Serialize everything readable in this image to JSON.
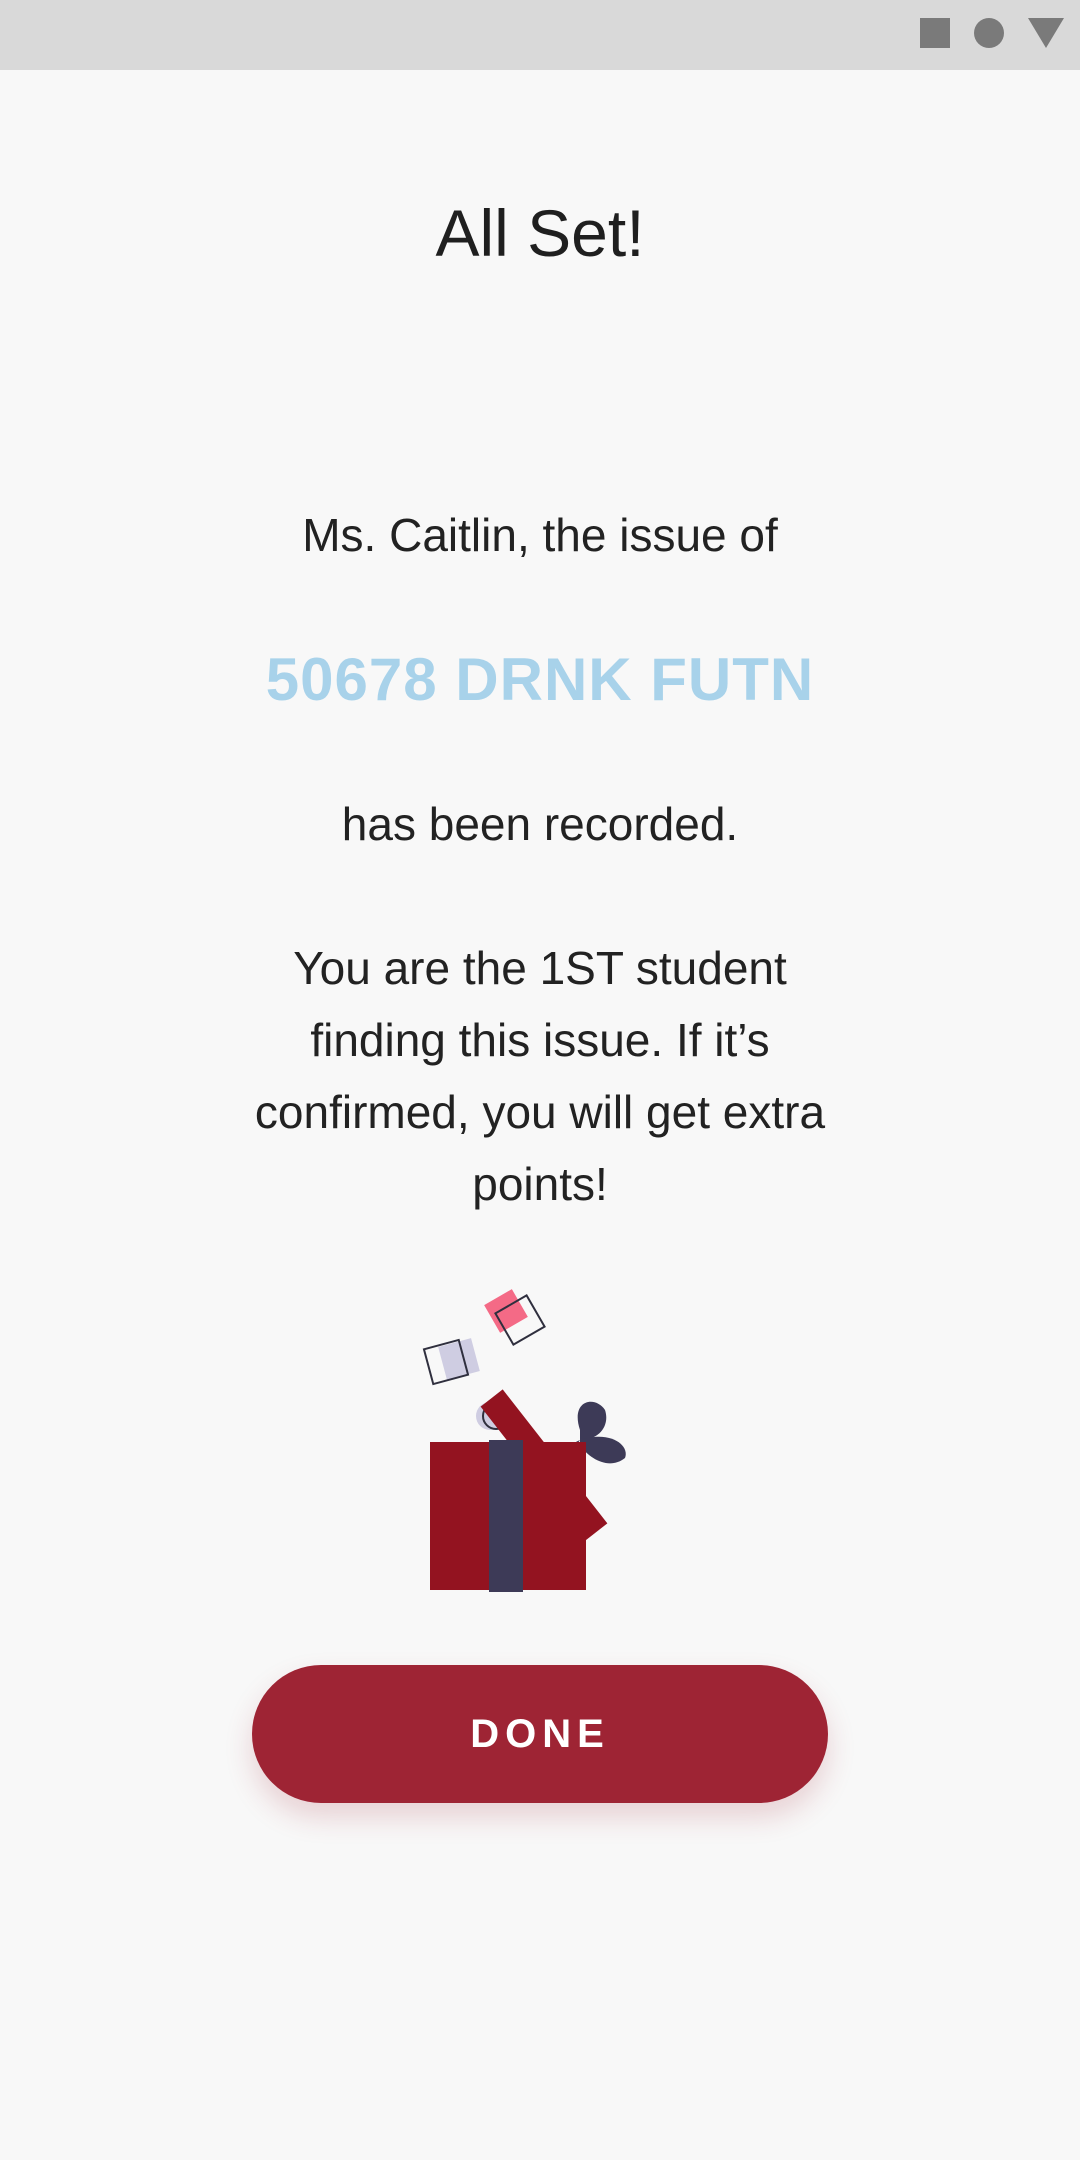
{
  "status_bar": {
    "icons": [
      "square-icon",
      "circle-icon",
      "triangle-icon"
    ]
  },
  "header": {
    "title": "All Set!"
  },
  "message": {
    "lead": "Ms. Caitlin, the issue of",
    "issue_code": "50678 DRNK FUTN",
    "recorded": "has been recorded.",
    "extra_points": "You are the 1ST student finding this issue. If it’s confirmed, you will get extra points!"
  },
  "illustration": {
    "icon": "gift-box-icon"
  },
  "actions": {
    "done_label": "DONE"
  },
  "colors": {
    "accent": "#9e2434",
    "issue_code": "#a8d2ea",
    "gift_box": "#931320",
    "ribbon": "#3d3a57",
    "confetti_pink": "#f46a86",
    "confetti_lilac": "#cfcde2"
  }
}
